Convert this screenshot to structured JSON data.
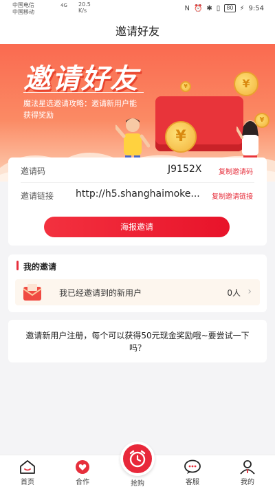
{
  "status_bar": {
    "carrier1": "中国电信",
    "carrier2": "中国移动",
    "network": "4G",
    "speed": "20.5",
    "speed_unit": "K/s",
    "battery": "80",
    "time": "9:54"
  },
  "navbar": {
    "title": "邀请好友"
  },
  "banner": {
    "headline": "邀请好友",
    "desc": "魔法星选邀请攻略：邀请新用户能获得奖励"
  },
  "invite": {
    "code_label": "邀请码",
    "code_value": "J9152X",
    "code_copy": "复制邀请码",
    "link_label": "邀请链接",
    "link_value": "http://h5.shanghaimoke...",
    "link_copy": "复制邀请链接",
    "poster_button": "海报邀请"
  },
  "my_invite": {
    "title": "我的邀请",
    "row_label": "我已经邀请到的新用户",
    "count": "0人"
  },
  "reward": {
    "text": "邀请新用户注册，每个可以获得50元现金奖励哦~要尝试一下吗？"
  },
  "tabbar": {
    "items": [
      {
        "label": "首页",
        "icon": "home-icon"
      },
      {
        "label": "合作",
        "icon": "heart-icon"
      },
      {
        "label": "抢购",
        "icon": "alarm-clock-icon"
      },
      {
        "label": "客服",
        "icon": "chat-icon"
      },
      {
        "label": "我的",
        "icon": "user-icon"
      }
    ]
  },
  "colors": {
    "accent": "#e62f3c",
    "banner": "#fa6a50"
  }
}
